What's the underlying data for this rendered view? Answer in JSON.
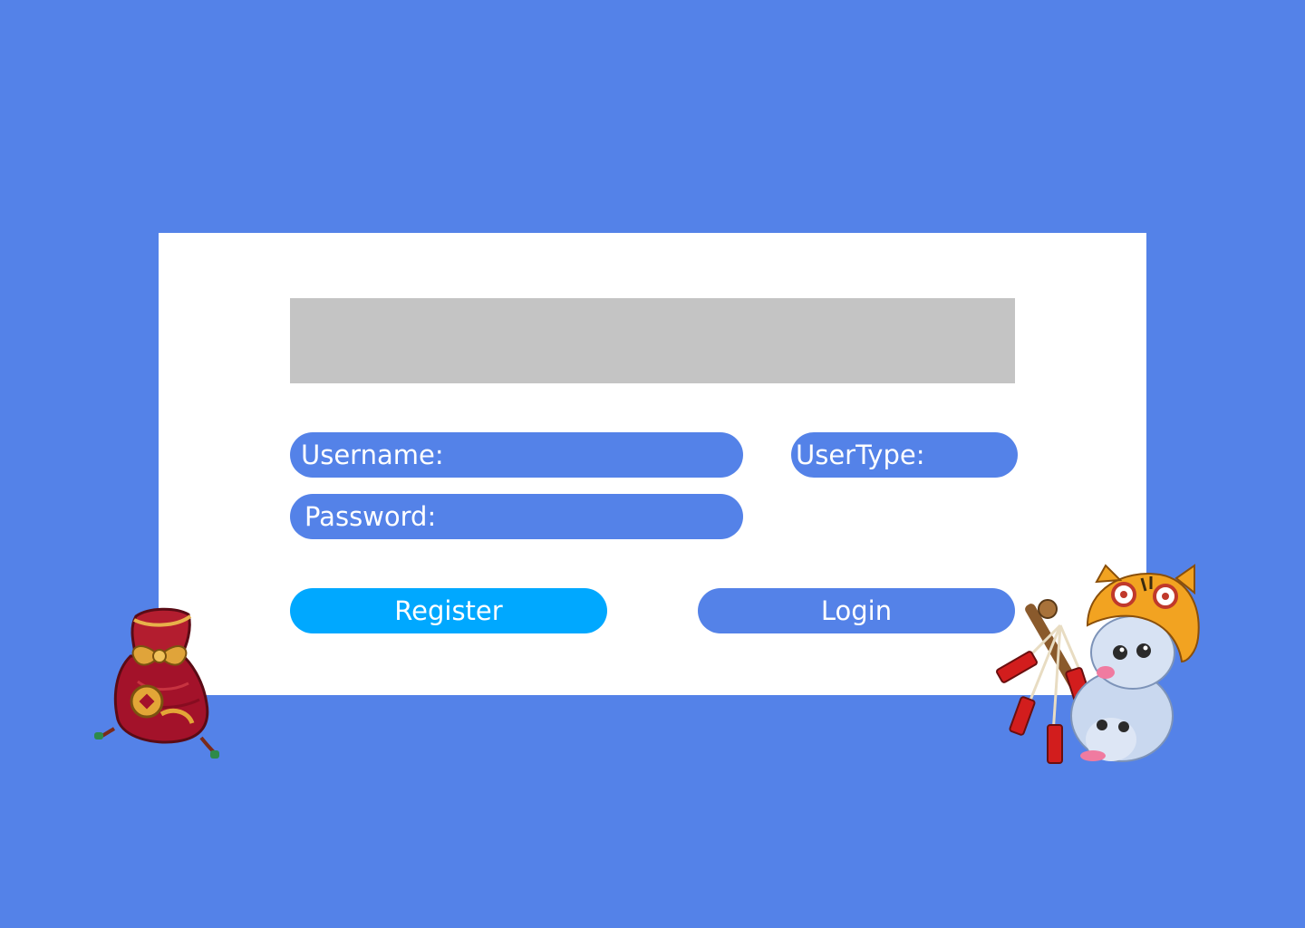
{
  "form": {
    "username_label": "Username:",
    "password_label": "Password:",
    "usertype_label": "UserType:"
  },
  "actions": {
    "register_label": "Register",
    "login_label": "Login"
  },
  "colors": {
    "page_background": "#5482e8",
    "card_background": "#ffffff",
    "banner_placeholder": "#c4c4c4",
    "field_background": "#5482e8",
    "register_button": "#00a8ff",
    "login_button": "#5482e8"
  },
  "decorations": {
    "left": "lucky-pouch-icon",
    "right": "poro-with-firecrackers-icon"
  }
}
